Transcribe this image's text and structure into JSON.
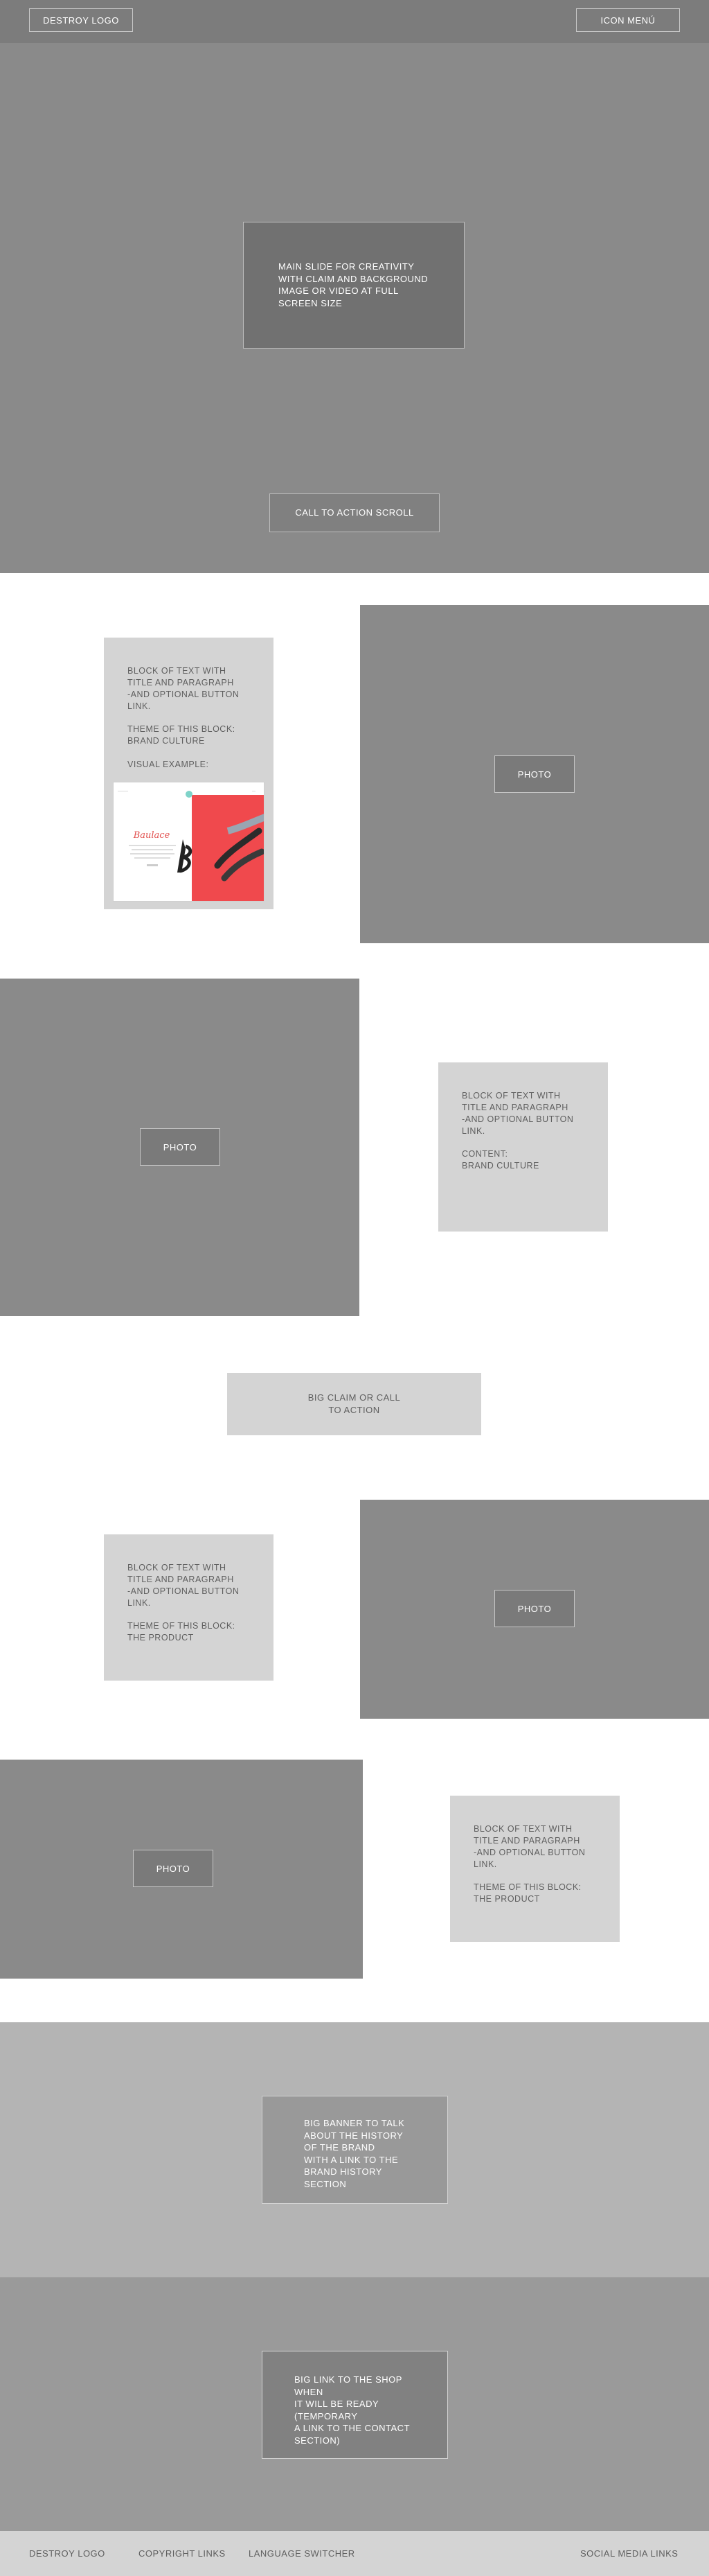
{
  "header": {
    "logo_label": "DESTROY LOGO",
    "menu_label": "ICON MENÚ"
  },
  "hero": {
    "main_text": "MAIN SLIDE FOR CREATIVITY\nWITH CLAIM AND BACKGROUND\nIMAGE OR VIDEO AT FULL\nSCREEN SIZE",
    "cta_label": "CALL TO ACTION SCROLL"
  },
  "section1": {
    "text": "BLOCK OF TEXT WITH\nTITLE AND PARAGRAPH\n-AND OPTIONAL BUTTON\nLINK.\n\nTHEME OF THIS BLOCK:\nBRAND CULTURE\n\nVISUAL EXAMPLE:",
    "photo_label": "PHOTO",
    "example_script": "Baulace"
  },
  "section2": {
    "photo_label": "PHOTO",
    "text": "BLOCK OF TEXT WITH\nTITLE AND PARAGRAPH\n-AND OPTIONAL BUTTON\nLINK.\n\nCONTENT:\nBRAND CULTURE"
  },
  "claim": {
    "text": "BIG CLAIM OR CALL\nTO ACTION"
  },
  "section3": {
    "text": "BLOCK OF TEXT WITH\nTITLE AND PARAGRAPH\n-AND OPTIONAL BUTTON\nLINK.\n\nTHEME OF THIS BLOCK:\nTHE PRODUCT",
    "photo_label": "PHOTO"
  },
  "section4": {
    "photo_label": "PHOTO",
    "text": "BLOCK OF TEXT WITH\nTITLE AND PARAGRAPH\n-AND OPTIONAL BUTTON\nLINK.\n\nTHEME OF THIS BLOCK:\nTHE PRODUCT"
  },
  "banner_history": {
    "text": "BIG BANNER TO TALK\nABOUT THE HISTORY\nOF THE BRAND\nWITH A LINK TO THE\nBRAND HISTORY\nSECTION"
  },
  "banner_shop": {
    "text": "BIG LINK TO THE SHOP WHEN\nIT WILL BE READY\n(TEMPORARY\nA LINK TO THE CONTACT\nSECTION)"
  },
  "footer": {
    "logo": "DESTROY LOGO",
    "copyright": "COPYRIGHT LINKS",
    "language": "LANGUAGE SWITCHER",
    "social": "SOCIAL MEDIA LINKS"
  },
  "colors": {
    "header_bg": "#7c7c7c",
    "hero_bg": "#8a8a8a",
    "text_block_bg": "#d4d4d4",
    "example_red": "#f0494d"
  }
}
